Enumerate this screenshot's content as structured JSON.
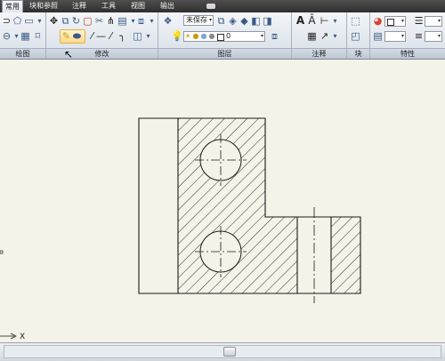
{
  "tabs": [
    {
      "label": "常用",
      "active": true
    },
    {
      "label": "块和参照",
      "active": false
    },
    {
      "label": "注释",
      "active": false
    },
    {
      "label": "工具",
      "active": false
    },
    {
      "label": "视图",
      "active": false
    },
    {
      "label": "输出",
      "active": false
    }
  ],
  "panels": {
    "draw": {
      "title": "绘图"
    },
    "modify": {
      "title": "修改"
    },
    "layers": {
      "title": "图层"
    },
    "annotation": {
      "title": "注释"
    },
    "block": {
      "title": "块"
    },
    "properties": {
      "title": "特性"
    }
  },
  "layers": {
    "layer_state_value": "未保存",
    "current_layer_value": "0"
  },
  "drawing": {
    "ucs_x_label": "X"
  },
  "colors": {
    "tab_bar": "#3a3a3a",
    "ribbon": "#dde3ea",
    "canvas": "#f4f3e8",
    "lines": "#1a1a1a"
  },
  "icons": [
    "polyline-icon",
    "polygon-icon",
    "move-icon",
    "rotate-icon",
    "copy-icon",
    "trim-icon",
    "mirror-icon",
    "fillet-icon",
    "stretch-icon",
    "scale-icon",
    "array-icon",
    "explode-icon",
    "offset-icon",
    "layer-properties-icon",
    "layer-state-icon",
    "text-icon",
    "dimension-icon",
    "table-icon",
    "leader-icon",
    "insert-block-icon",
    "color-icon",
    "lineweight-icon",
    "linetype-icon"
  ]
}
